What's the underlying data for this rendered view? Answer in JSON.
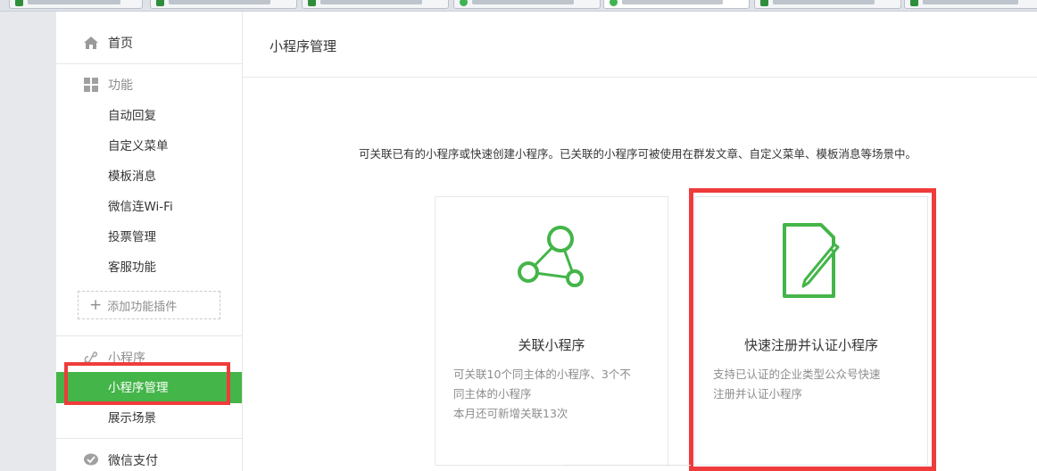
{
  "browser_tabs": [
    {
      "icon": "tab-favicon",
      "active": false
    },
    {
      "icon": "tab-favicon",
      "active": false
    },
    {
      "icon": "tab-favicon",
      "active": false
    },
    {
      "icon": "wechat-favicon",
      "active": false
    },
    {
      "icon": "wechat-favicon",
      "active": true
    },
    {
      "icon": "tab-favicon",
      "active": false
    },
    {
      "icon": "tab-favicon",
      "active": false
    }
  ],
  "sidebar": {
    "home": {
      "label": "首页",
      "icon": "home-icon"
    },
    "features": {
      "label": "功能",
      "icon": "grid-icon",
      "items": [
        "自动回复",
        "自定义菜单",
        "模板消息",
        "微信连Wi-Fi",
        "投票管理",
        "客服功能"
      ],
      "add_plugin": "添加功能插件"
    },
    "miniprogram": {
      "label": "小程序",
      "icon": "link-icon",
      "items": [
        "小程序管理",
        "展示场景"
      ],
      "active_index": 0
    },
    "pay": {
      "label": "微信支付",
      "icon": "wechat-pay-icon"
    }
  },
  "main": {
    "title": "小程序管理",
    "description": "可关联已有的小程序或快速创建小程序。已关联的小程序可被使用在群发文章、自定义菜单、模板消息等场景中。",
    "cards": [
      {
        "title": "关联小程序",
        "icon": "network-link-icon",
        "lines": [
          "可关联10个同主体的小程序、3个不",
          "同主体的小程序",
          "本月还可新增关联13次"
        ]
      },
      {
        "title": "快速注册并认证小程序",
        "icon": "document-edit-icon",
        "lines": [
          "支持已认证的企业类型公众号快速",
          "注册并认证小程序"
        ]
      }
    ]
  },
  "colors": {
    "accent": "#44b549",
    "highlight": "#ef3b3b",
    "muted_text": "#8d8d8d"
  }
}
